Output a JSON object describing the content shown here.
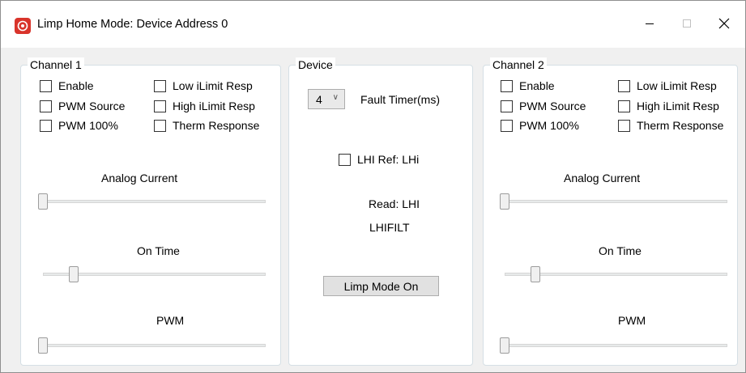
{
  "window": {
    "title": "Limp Home Mode: Device Address 0",
    "controls": {
      "minimize": "minimize-icon",
      "maximize": "maximize-icon",
      "close": "close-icon"
    }
  },
  "channel1": {
    "title": "Channel 1",
    "checkboxes": {
      "enable": "Enable",
      "pwm_source": "PWM Source",
      "pwm_100": "PWM 100%",
      "low_ilimit": "Low iLimit Resp",
      "high_ilimit": "High iLimit Resp",
      "therm": "Therm Response"
    },
    "analog_current_label": "Analog Current",
    "analog_current_value": 0,
    "on_time_label": "On Time",
    "on_time_value": 0.12,
    "pwm_label": "PWM",
    "pwm_value": 0
  },
  "device": {
    "title": "Device",
    "fault_timer_value": "4",
    "fault_timer_label": "Fault Timer(ms)",
    "lhi_ref_label": "LHI Ref: LHi",
    "read_label": "Read: LHI",
    "lhifilt_label": "LHIFILT",
    "limp_button": "Limp Mode On"
  },
  "channel2": {
    "title": "Channel 2",
    "checkboxes": {
      "enable": "Enable",
      "pwm_source": "PWM Source",
      "pwm_100": "PWM 100%",
      "low_ilimit": "Low iLimit Resp",
      "high_ilimit": "High iLimit Resp",
      "therm": "Therm Response"
    },
    "analog_current_label": "Analog Current",
    "analog_current_value": 0,
    "on_time_label": "On Time",
    "on_time_value": 0.12,
    "pwm_label": "PWM",
    "pwm_value": 0
  },
  "colors": {
    "app_icon": "#d9342b",
    "panel_bg": "#ffffff",
    "window_bg": "#f0f0f0",
    "group_border": "#d5dfe5"
  }
}
